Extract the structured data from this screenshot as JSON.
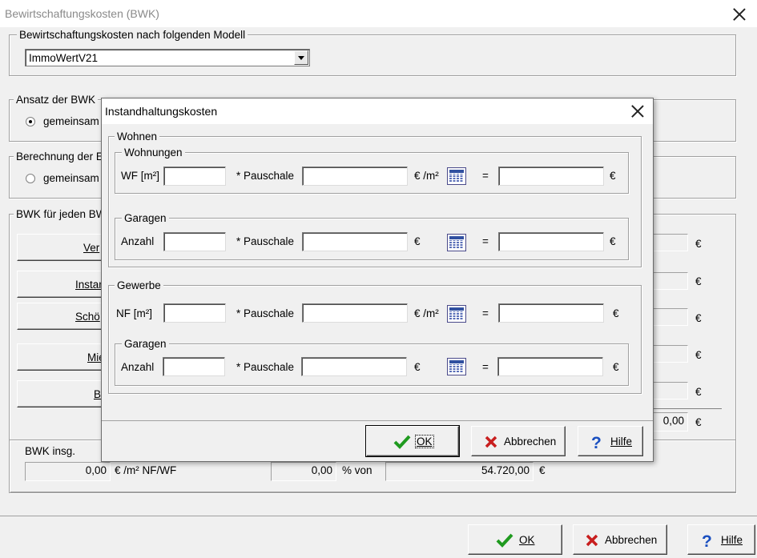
{
  "window": {
    "title": "Bewirtschaftungskosten (BWK)"
  },
  "model_group": {
    "legend": "Bewirtschaftungskosten nach folgenden Modell",
    "selected": "ImmoWertV21"
  },
  "ansatz_group": {
    "legend": "Ansatz der BWK",
    "option": "gemeinsam"
  },
  "berechnung_group": {
    "legend": "Berechnung der E",
    "option": "gemeinsam"
  },
  "bwk_each_group": {
    "legend": "BWK für jeden BW",
    "buttons": [
      "Ver",
      "Instan",
      "Schö",
      "Mie",
      "B"
    ],
    "currency": "€",
    "total_value": "0,00"
  },
  "bwk_total": {
    "label": "BWK insg.",
    "per_area_value": "0,00",
    "per_area_unit": "€ /m² NF/WF",
    "percent_value": "0,00",
    "percent_label": "% von",
    "base_value": "54.720,00",
    "currency": "€"
  },
  "footer": {
    "ok": "OK",
    "cancel": "Abbrechen",
    "help": "Hilfe"
  },
  "dialog": {
    "title": "Instandhaltungskosten",
    "wohnen": {
      "legend": "Wohnen",
      "wohnungen": {
        "legend": "Wohnungen",
        "label": "WF [m²]",
        "mult_label": "* Pauschale",
        "unit": "€ /m²",
        "eq": "=",
        "currency": "€"
      },
      "garagen": {
        "legend": "Garagen",
        "label": "Anzahl",
        "mult_label": "* Pauschale",
        "unit": "€",
        "eq": "=",
        "currency": "€"
      }
    },
    "gewerbe": {
      "legend": "Gewerbe",
      "flaeche": {
        "label": "NF [m²]",
        "mult_label": "* Pauschale",
        "unit": "€ /m²",
        "eq": "=",
        "currency": "€"
      },
      "garagen": {
        "legend": "Garagen",
        "label": "Anzahl",
        "mult_label": "* Pauschale",
        "unit": "€",
        "eq": "=",
        "currency": "€"
      }
    },
    "buttons": {
      "ok": "OK",
      "cancel": "Abbrechen",
      "help": "Hilfe"
    }
  },
  "icons": {
    "calendar": "calendar-icon",
    "ok": "checkmark-icon",
    "cancel": "x-icon",
    "help": "question-icon",
    "close": "close-icon"
  },
  "colors": {
    "accent_green": "#1f9a1f",
    "cancel_red": "#c81e1e",
    "help_blue": "#1a4fc0"
  }
}
